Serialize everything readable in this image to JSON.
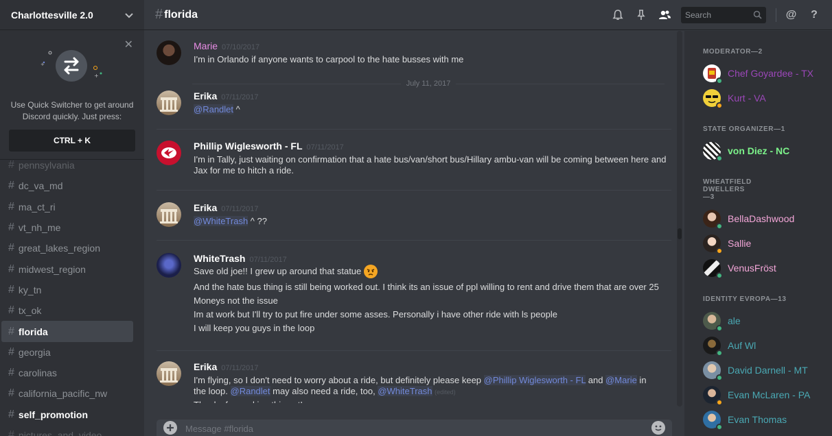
{
  "server": {
    "name": "Charlottesville 2.0"
  },
  "quick_switcher": {
    "text": "Use Quick Switcher to get around Discord quickly. Just press:",
    "shortcut": "CTRL + K"
  },
  "channels": [
    {
      "name": "pennsylvania",
      "state": "dim"
    },
    {
      "name": "dc_va_md",
      "state": "normal"
    },
    {
      "name": "ma_ct_ri",
      "state": "normal"
    },
    {
      "name": "vt_nh_me",
      "state": "normal"
    },
    {
      "name": "great_lakes_region",
      "state": "normal"
    },
    {
      "name": "midwest_region",
      "state": "normal"
    },
    {
      "name": "ky_tn",
      "state": "normal"
    },
    {
      "name": "tx_ok",
      "state": "normal"
    },
    {
      "name": "florida",
      "state": "active"
    },
    {
      "name": "georgia",
      "state": "normal"
    },
    {
      "name": "carolinas",
      "state": "normal"
    },
    {
      "name": "california_pacific_nw",
      "state": "normal"
    },
    {
      "name": "self_promotion",
      "state": "bold"
    },
    {
      "name": "pictures_and_video",
      "state": "dim"
    }
  ],
  "header": {
    "channel": "florida",
    "search_placeholder": "Search"
  },
  "date_separator": "July 11, 2017",
  "messages": {
    "m1": {
      "author": "Marie",
      "timestamp": "07/10/2017",
      "color": "#e98de6",
      "text": "I'm in Orlando if anyone wants to carpool to the hate busses with me"
    },
    "m2": {
      "author": "Erika",
      "timestamp": "07/11/2017",
      "mention": "@Randlet",
      "rest": " ^"
    },
    "m3": {
      "author": "Phillip Wiglesworth - FL",
      "timestamp": "07/11/2017",
      "text": "I'm in Tally, just waiting on confirmation that a hate bus/van/short bus/Hillary ambu-van will be coming between here and Jax for me to hitch a ride."
    },
    "m4": {
      "author": "Erika",
      "timestamp": "07/11/2017",
      "mention": "@WhiteTrash",
      "rest": " ^ ??"
    },
    "m5": {
      "author": "WhiteTrash",
      "timestamp": "07/11/2017",
      "lines": [
        "Save old joe!! I grew up around that statue",
        "And the hate bus thing is still being worked out.  I think its an issue of ppl willing to rent and drive them that are over 25",
        "Moneys not the issue",
        "Im at work but I'll try to put fire under some asses. Personally i have other ride with ls people",
        "I will keep you guys in the loop"
      ]
    },
    "m6": {
      "author": "Erika",
      "timestamp": "07/11/2017",
      "t1": "I'm flying, so I don't need to worry about a ride, but definitely please keep ",
      "mention1": "@Phillip Wiglesworth - FL",
      "t2": " and ",
      "mention2": "@Marie",
      "t3": " in the loop. ",
      "mention3": "@Randlet",
      "t4": " may also need a ride, too, ",
      "mention4": "@WhiteTrash",
      "edited": "(edited)",
      "cut_line": "Thanks for working this out!"
    }
  },
  "composer": {
    "placeholder": "Message #florida"
  },
  "members": {
    "moderator": {
      "title": "MODERATOR—2",
      "list": [
        {
          "name": "Chef Goyardee - TX",
          "color": "#9b47b8",
          "status": "online"
        },
        {
          "name": "Kurt - VA",
          "color": "#9b47b8",
          "status": "idle"
        }
      ]
    },
    "state_organizer": {
      "title": "STATE ORGANIZER—1",
      "list": [
        {
          "name": "von Diez - NC",
          "color": "#7cf28a",
          "status": "online"
        }
      ]
    },
    "wheatfield": {
      "title": "WHEATFIELD DWELLERS—3",
      "list": [
        {
          "name": "BellaDashwood",
          "color": "#f3a6d8",
          "status": "online"
        },
        {
          "name": "Sallie",
          "color": "#f3a6d8",
          "status": "idle"
        },
        {
          "name": "VenusFröst",
          "color": "#f3a6d8",
          "status": "online"
        }
      ]
    },
    "identity": {
      "title": "IDENTITY EVROPA—13",
      "list": [
        {
          "name": "ale",
          "color": "#4aa9b4",
          "status": "online"
        },
        {
          "name": "Auf Wl",
          "color": "#4aa9b4",
          "status": "online"
        },
        {
          "name": "David Darnell - MT",
          "color": "#4aa9b4",
          "status": "online"
        },
        {
          "name": "Evan McLaren - PA",
          "color": "#4aa9b4",
          "status": "idle"
        },
        {
          "name": "Evan Thomas",
          "color": "#4aa9b4",
          "status": "online"
        }
      ]
    }
  },
  "colors": {
    "online": "#43b581",
    "idle": "#faa61a",
    "mention": "#7289da"
  }
}
